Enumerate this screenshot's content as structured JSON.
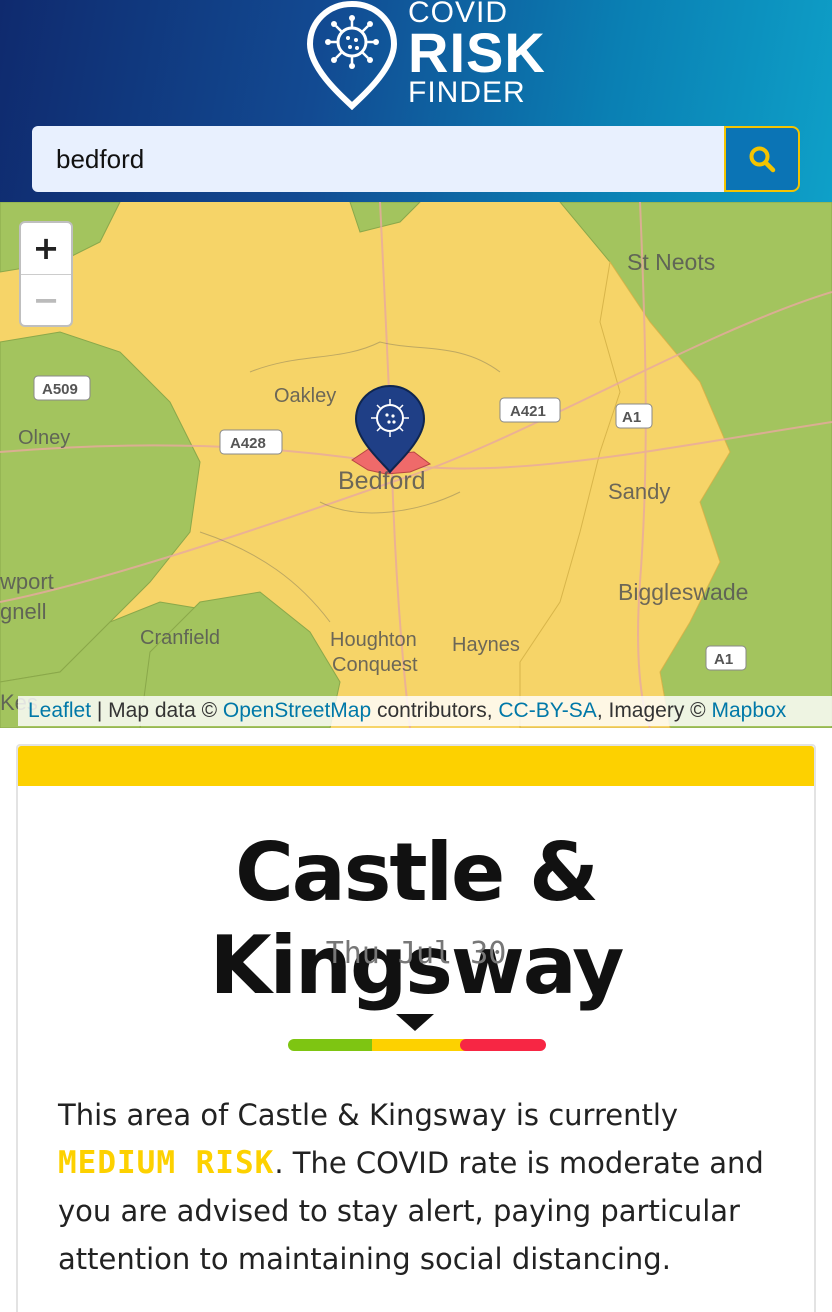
{
  "logo": {
    "line1": "COVID",
    "line2": "RISK",
    "line3": "FINDER"
  },
  "search": {
    "value": "bedford",
    "button_icon": "search-icon"
  },
  "map": {
    "zoom_in_label": "+",
    "zoom_out_label": "−",
    "place_labels": [
      "St Neots",
      "Oakley",
      "Bedford",
      "Olney",
      "Sandy",
      "Biggleswade",
      "Cranfield",
      "Houghton",
      "Conquest",
      "Haynes"
    ],
    "road_labels": [
      "A509",
      "A428",
      "A421",
      "A1",
      "A1"
    ],
    "edge_labels": [
      "wport",
      "gnell",
      "Kes"
    ],
    "marker_icon": "virus-pin-icon",
    "colors": {
      "medium": "#f6d468",
      "low": "#a3c45e",
      "high": "#ef6a6a",
      "marker": "#1f3f86"
    }
  },
  "attribution": {
    "leaflet": "Leaflet",
    "sep1": " | Map data © ",
    "osm": "OpenStreetMap",
    "contributors": " contributors, ",
    "license": "CC-BY-SA",
    "imagery": ", Imagery © ",
    "mapbox": "Mapbox"
  },
  "result": {
    "area_name": "Castle & Kingsway",
    "date": "Thu Jul 30",
    "risk_level_label": "MEDIUM RISK",
    "desc_prefix": "This area of Castle & Kingsway is currently ",
    "desc_suffix": ". The COVID rate is moderate and you are advised to stay alert, paying particular attention to maintaining social distancing.",
    "gauge_colors": {
      "low": "#7ec512",
      "medium": "#fdd100",
      "high": "#f72644"
    },
    "gauge_position": "medium",
    "accent": "#fdd100"
  }
}
